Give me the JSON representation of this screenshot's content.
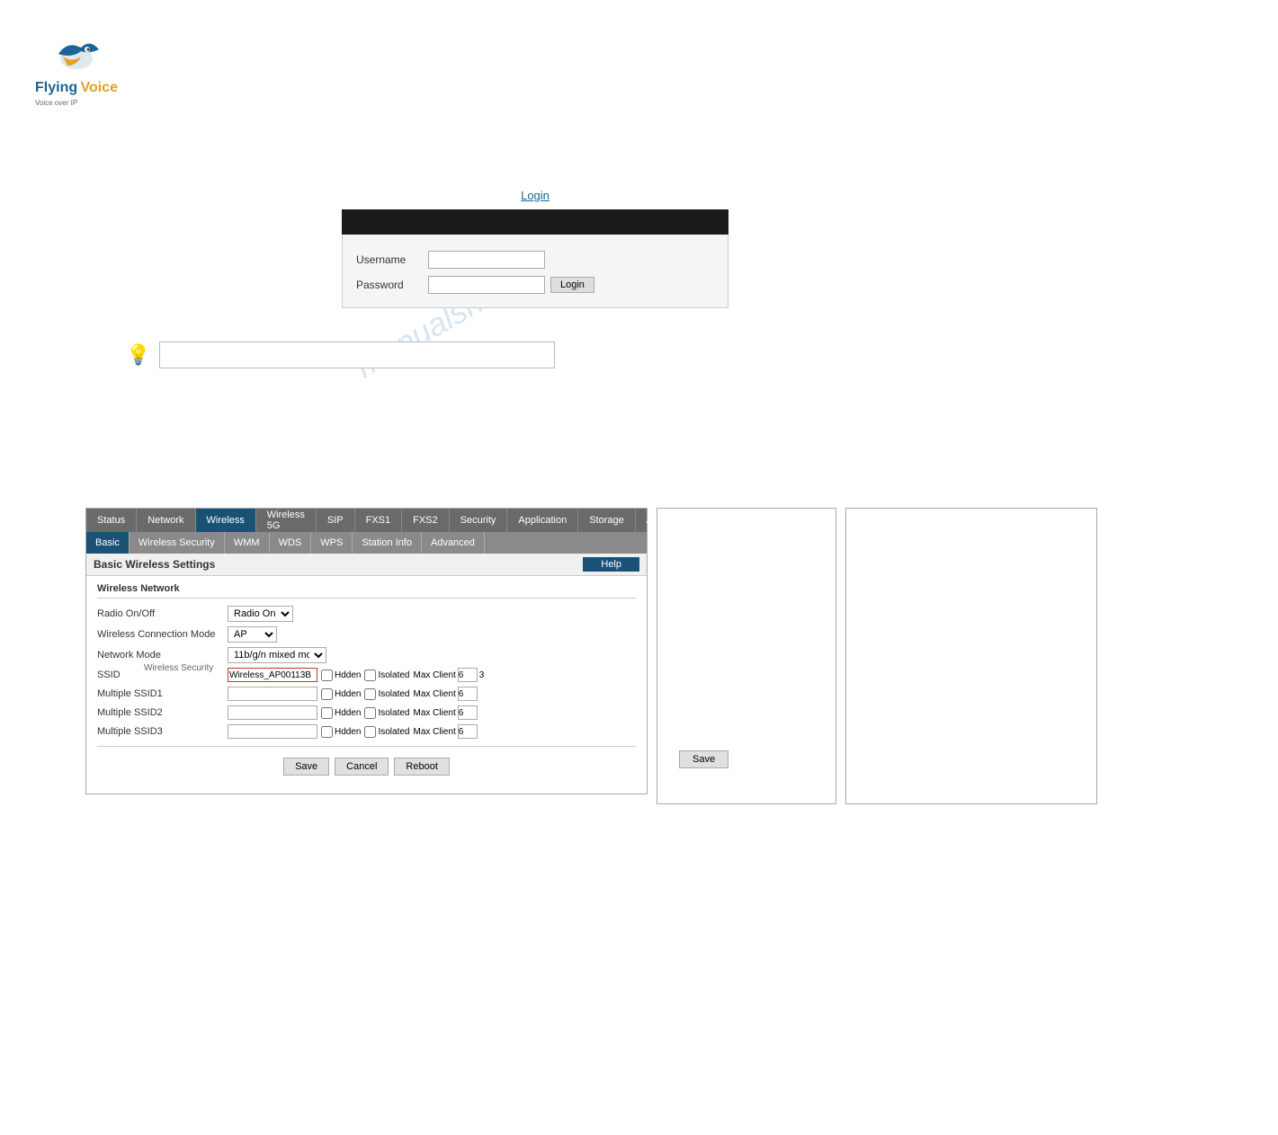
{
  "logo": {
    "flying": "Flying",
    "voice": "Voice",
    "sub": "Voice over IP"
  },
  "login": {
    "title": "Login",
    "header_bar": "",
    "username_label": "Username",
    "password_label": "Password",
    "username_value": "",
    "password_value": "",
    "login_button": "Login"
  },
  "tip": {
    "bulb": "💡",
    "input_value": ""
  },
  "watermark": "manualshlve.com",
  "nav": {
    "top_tabs": [
      {
        "id": "status",
        "label": "Status",
        "active": false
      },
      {
        "id": "network",
        "label": "Network",
        "active": false
      },
      {
        "id": "wireless",
        "label": "Wireless",
        "active": true
      },
      {
        "id": "wireless5g",
        "label": "Wireless 5G",
        "active": false
      },
      {
        "id": "sip",
        "label": "SIP",
        "active": false
      },
      {
        "id": "fxs1",
        "label": "FXS1",
        "active": false
      },
      {
        "id": "fxs2",
        "label": "FXS2",
        "active": false
      },
      {
        "id": "security",
        "label": "Security",
        "active": false
      },
      {
        "id": "application",
        "label": "Application",
        "active": false
      },
      {
        "id": "storage",
        "label": "Storage",
        "active": false
      },
      {
        "id": "administration",
        "label": "Administration",
        "active": false
      }
    ],
    "sub_tabs": [
      {
        "id": "basic",
        "label": "Basic",
        "active": true
      },
      {
        "id": "wireless_security",
        "label": "Wireless Security",
        "active": false
      },
      {
        "id": "wmm",
        "label": "WMM",
        "active": false
      },
      {
        "id": "wds",
        "label": "WDS",
        "active": false
      },
      {
        "id": "wps",
        "label": "WPS",
        "active": false
      },
      {
        "id": "station_info",
        "label": "Station Info",
        "active": false
      },
      {
        "id": "advanced",
        "label": "Advanced",
        "active": false
      }
    ]
  },
  "content": {
    "header": "Basic Wireless Settings",
    "help_button": "Help",
    "section": "Wireless Network",
    "fields": [
      {
        "label": "Radio On/Off",
        "type": "select",
        "value": "Radio On"
      },
      {
        "label": "Wireless Connection Mode",
        "type": "select",
        "value": "AP"
      },
      {
        "label": "Network Mode",
        "type": "select",
        "value": "11b/g/n mixed mode"
      }
    ],
    "ssid": {
      "label": "SSID",
      "value": "Wireless_AP00113B",
      "hidden_label": "Hdden",
      "hidden_checked": false,
      "isolated_label": "Isolated",
      "isolated_checked": false,
      "max_client_label": "Max Client",
      "max_client_value": "6"
    },
    "multiple_ssids": [
      {
        "label": "Multiple SSID1",
        "value": "",
        "hidden_checked": false,
        "isolated_checked": false,
        "max_client": "6"
      },
      {
        "label": "Multiple SSID2",
        "value": "",
        "hidden_checked": false,
        "isolated_checked": false,
        "max_client": "6"
      },
      {
        "label": "Multiple SSID3",
        "value": "",
        "hidden_checked": false,
        "isolated_checked": false,
        "max_client": "6"
      }
    ]
  },
  "actions": {
    "save": "Save",
    "cancel": "Cancel",
    "reboot": "Reboot"
  },
  "right_save": "Save",
  "wireless_security_label": "Wireless Security"
}
